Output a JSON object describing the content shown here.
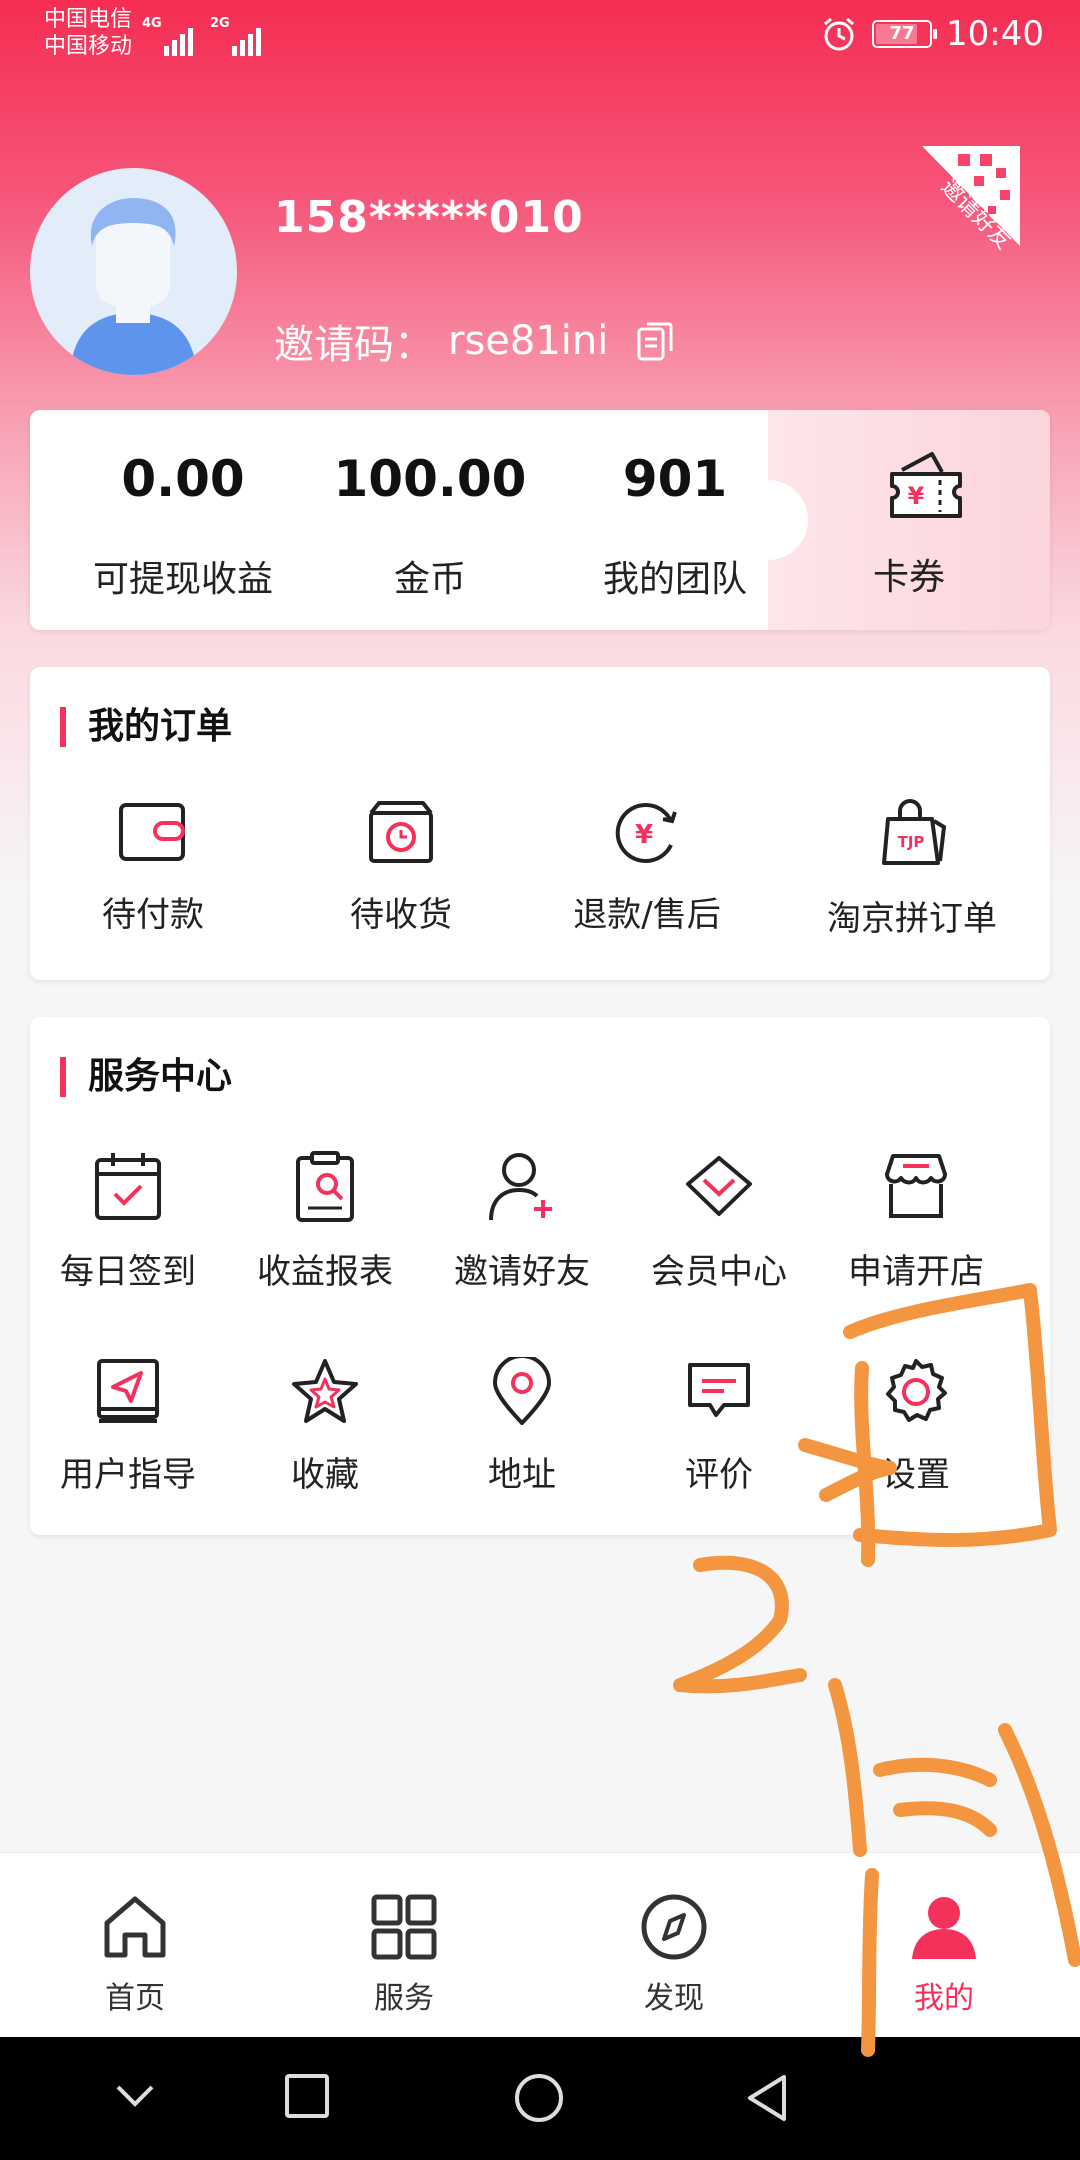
{
  "status_bar": {
    "carrier1": "中国电信",
    "carrier2": "中国移动",
    "net1": "4G",
    "net2": "2G",
    "battery": "77",
    "time": "10:40"
  },
  "profile": {
    "phone": "158*****010",
    "invite_label": "邀请码：",
    "invite_code": "rse81ini",
    "invite_badge": "邀请好友"
  },
  "stats": [
    {
      "value": "0.00",
      "label": "可提现收益"
    },
    {
      "value": "100.00",
      "label": "金币"
    },
    {
      "value": "901",
      "label": "我的团队"
    }
  ],
  "coupon": {
    "label": "卡券",
    "icon": "ticket-icon"
  },
  "orders": {
    "title": "我的订单",
    "items": [
      {
        "label": "待付款",
        "icon": "wallet-icon"
      },
      {
        "label": "待收货",
        "icon": "package-clock-icon"
      },
      {
        "label": "退款/售后",
        "icon": "refund-icon"
      },
      {
        "label": "淘京拼订单",
        "icon": "shopping-bag-icon",
        "icon_text": "TJP"
      }
    ]
  },
  "services": {
    "title": "服务中心",
    "items": [
      {
        "label": "每日签到",
        "icon": "calendar-check-icon"
      },
      {
        "label": "收益报表",
        "icon": "report-icon"
      },
      {
        "label": "邀请好友",
        "icon": "add-user-icon"
      },
      {
        "label": "会员中心",
        "icon": "diamond-icon"
      },
      {
        "label": "申请开店",
        "icon": "store-icon"
      },
      {
        "label": "用户指导",
        "icon": "guide-book-icon"
      },
      {
        "label": "收藏",
        "icon": "star-icon"
      },
      {
        "label": "地址",
        "icon": "location-pin-icon"
      },
      {
        "label": "评价",
        "icon": "comment-icon"
      },
      {
        "label": "设置",
        "icon": "gear-icon"
      }
    ]
  },
  "nav": {
    "items": [
      {
        "label": "首页",
        "icon": "home-icon"
      },
      {
        "label": "服务",
        "icon": "grid-icon"
      },
      {
        "label": "发现",
        "icon": "compass-icon"
      },
      {
        "label": "我的",
        "icon": "user-icon",
        "active": true
      }
    ]
  },
  "colors": {
    "accent": "#f4315a",
    "annotation": "#f4953f"
  }
}
